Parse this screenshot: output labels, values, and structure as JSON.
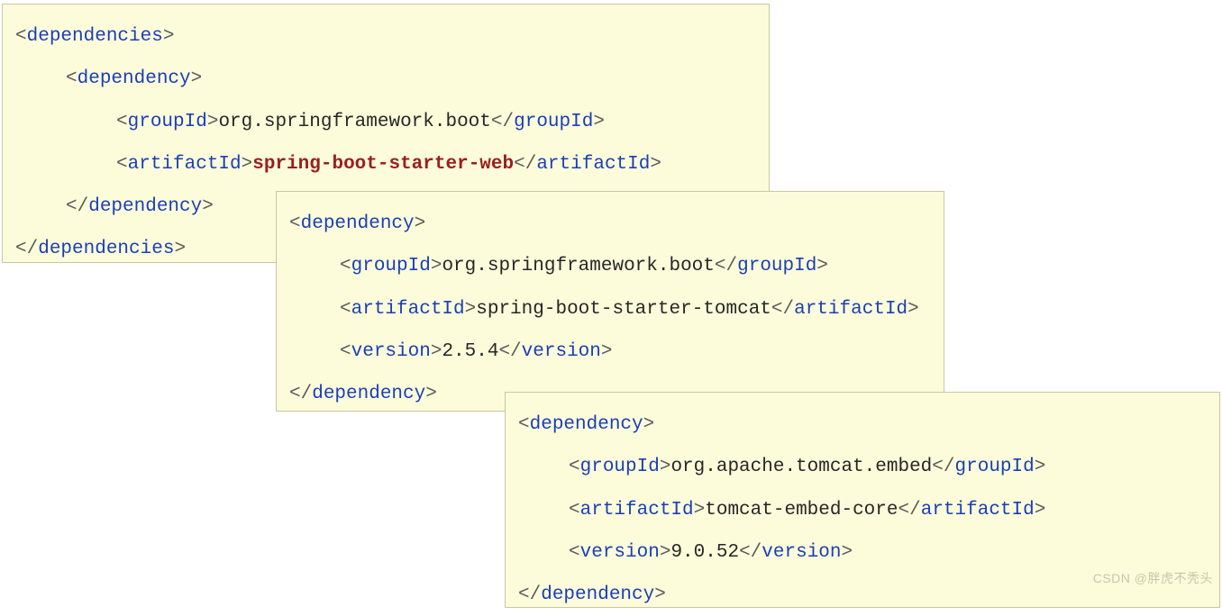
{
  "box1": {
    "tags": {
      "dependencies": "dependencies",
      "dependency": "dependency",
      "groupId": "groupId",
      "artifactId": "artifactId"
    },
    "groupId_value": "org.springframework.boot",
    "artifactId_value": "spring-boot-starter-web"
  },
  "box2": {
    "tags": {
      "dependency": "dependency",
      "groupId": "groupId",
      "artifactId": "artifactId",
      "version": "version"
    },
    "groupId_value": "org.springframework.boot",
    "artifactId_value": "spring-boot-starter-tomcat",
    "version_value": "2.5.4"
  },
  "box3": {
    "tags": {
      "dependency": "dependency",
      "groupId": "groupId",
      "artifactId": "artifactId",
      "version": "version"
    },
    "groupId_value": "org.apache.tomcat.embed",
    "artifactId_value": "tomcat-embed-core",
    "version_value": "9.0.52"
  },
  "watermark": "CSDN @胖虎不秃头"
}
